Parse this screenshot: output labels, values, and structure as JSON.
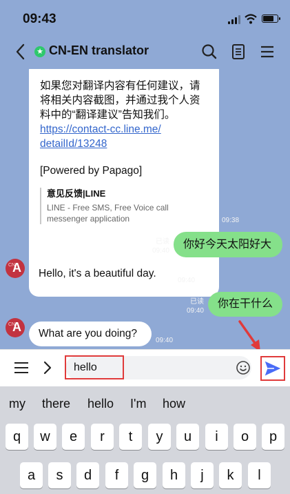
{
  "status_bar": {
    "time": "09:43",
    "battery_level": 0.8
  },
  "header": {
    "title": "CN-EN translator",
    "badge_glyph": "★"
  },
  "messages": {
    "info": {
      "line1": "如果您对翻译内容有任何建议，请",
      "line2": "将相关内容截图，并通过我个人资",
      "line3": "料中的“翻译建议”告知我们。",
      "link_line1": "https://contact-cc.line.me/",
      "link_line2": "detailId/13248",
      "powered": "[Powered by Papago]",
      "preview_title": "意见反馈|LINE",
      "preview_desc_line1": "LINE - Free SMS, Free Voice call",
      "preview_desc_line2": "messenger application",
      "time": "09:38"
    },
    "sent1": {
      "text": "你好今天太阳好大",
      "read": "已读",
      "time": "09:40"
    },
    "recv1": {
      "text": "Hello, it's a beautiful day.",
      "time": "09:40"
    },
    "sent2": {
      "text": "你在干什么",
      "read": "已读",
      "time": "09:40"
    },
    "recv2": {
      "text": "What are you doing?",
      "time": "09:40"
    }
  },
  "avatar": {
    "letter": "A",
    "dot_text": "CN"
  },
  "input": {
    "value": "hello"
  },
  "keyboard": {
    "suggestions": [
      "my",
      "there",
      "hello",
      "I'm",
      "how"
    ],
    "row1": [
      "q",
      "w",
      "e",
      "r",
      "t",
      "y",
      "u",
      "i",
      "o",
      "p"
    ],
    "row2": [
      "a",
      "s",
      "d",
      "f",
      "g",
      "h",
      "j",
      "k",
      "l"
    ]
  },
  "colors": {
    "background": "#8fa9d5",
    "sent_bubble": "#85e08a",
    "received_bubble": "#ffffff",
    "annotation_red": "#e03a3a",
    "send_icon": "#4a6cf7",
    "link": "#3366cc"
  },
  "icons": {
    "back": "chevron-left-icon",
    "search": "search-icon",
    "notes": "notes-icon",
    "menu": "hamburger-menu-icon",
    "expand": "chevron-right-icon",
    "emoji": "emoji-icon",
    "send": "send-icon"
  }
}
